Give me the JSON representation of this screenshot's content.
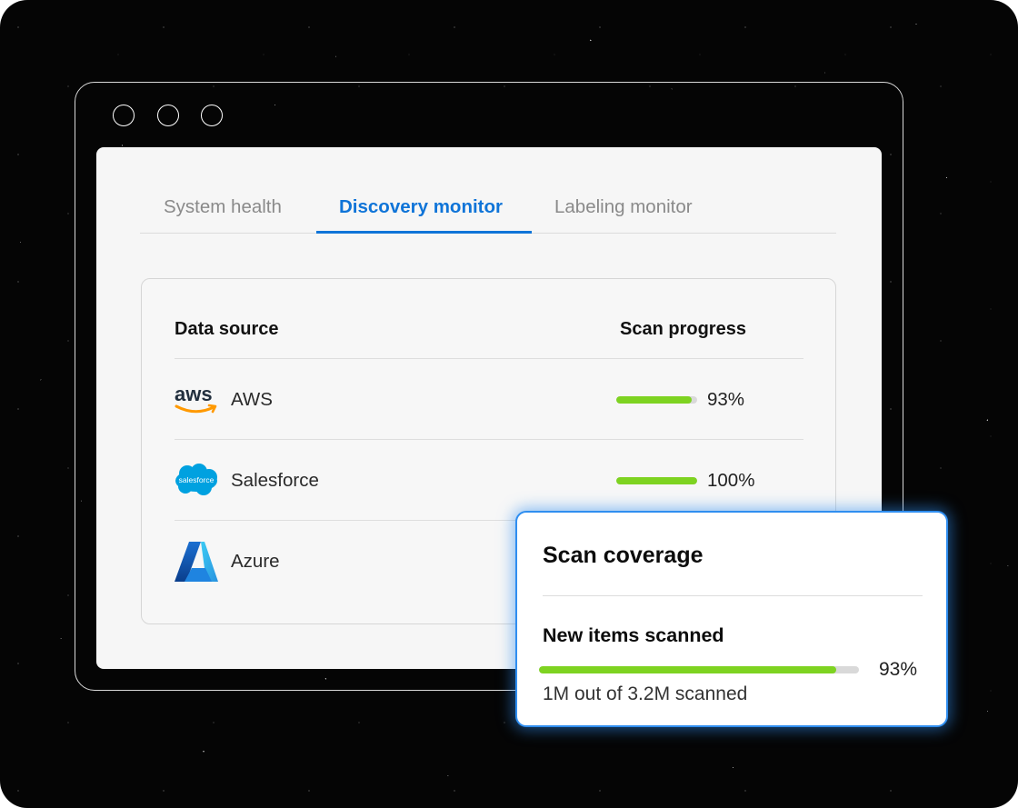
{
  "tabs": [
    {
      "label": "System health",
      "active": false
    },
    {
      "label": "Discovery monitor",
      "active": true
    },
    {
      "label": "Labeling monitor",
      "active": false
    }
  ],
  "table": {
    "headers": {
      "source": "Data source",
      "progress": "Scan progress"
    },
    "rows": [
      {
        "name": "AWS",
        "logo": "aws-logo",
        "progress": 0.93,
        "progress_label": "93%"
      },
      {
        "name": "Salesforce",
        "logo": "salesforce-logo",
        "progress": 1.0,
        "progress_label": "100%"
      },
      {
        "name": "Azure",
        "logo": "azure-logo"
      }
    ]
  },
  "popup": {
    "title": "Scan coverage",
    "subtitle": "New items scanned",
    "progress": 0.93,
    "progress_label": "93%",
    "note": "1M out of 3.2M scanned"
  },
  "logos": {
    "aws_text": "aws",
    "salesforce_text": "salesforce"
  },
  "colors": {
    "accent": "#0f74d8",
    "progress": "#7ed321",
    "popup_border": "#2f8ef0"
  }
}
